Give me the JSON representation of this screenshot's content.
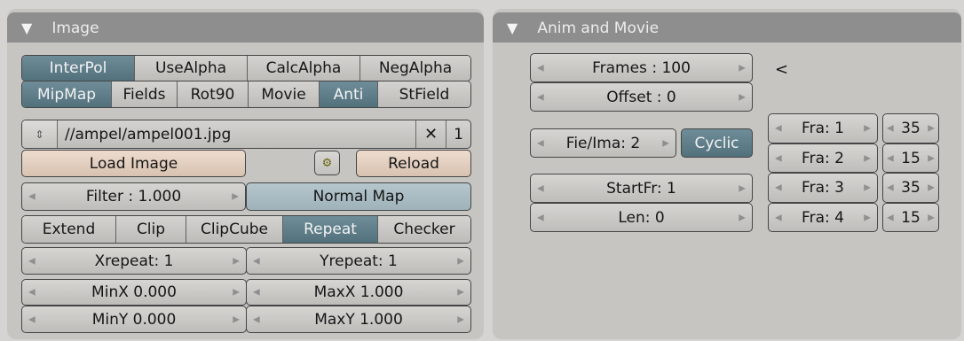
{
  "image_panel": {
    "header_title": "Image",
    "toggle_row1": [
      {
        "label": "InterPol",
        "active": true
      },
      {
        "label": "UseAlpha",
        "active": false
      },
      {
        "label": "CalcAlpha",
        "active": false
      },
      {
        "label": "NegAlpha",
        "active": false
      }
    ],
    "toggle_row2": [
      {
        "label": "MipMap",
        "active": true
      },
      {
        "label": "Fields",
        "active": false
      },
      {
        "label": "Rot90",
        "active": false
      },
      {
        "label": "Movie",
        "active": false
      },
      {
        "label": "Anti",
        "active": true
      },
      {
        "label": "StField",
        "active": false
      }
    ],
    "file_path": "//ampel/ampel001.jpg",
    "user_count": "1",
    "load_image_label": "Load Image",
    "reload_label": "Reload",
    "filter_label": "Filter : 1.000",
    "normal_map_label": "Normal Map",
    "extend_modes": [
      {
        "label": "Extend",
        "active": false
      },
      {
        "label": "Clip",
        "active": false
      },
      {
        "label": "ClipCube",
        "active": false
      },
      {
        "label": "Repeat",
        "active": true
      },
      {
        "label": "Checker",
        "active": false
      }
    ],
    "xrepeat": "Xrepeat: 1",
    "yrepeat": "Yrepeat: 1",
    "minx": "MinX 0.000",
    "maxx": "MaxX 1.000",
    "miny": "MinY 0.000",
    "maxy": "MaxY 1.000"
  },
  "anim_panel": {
    "header_title": "Anim and Movie",
    "frames": "Frames : 100",
    "offset": "Offset : 0",
    "arrow_text": "<",
    "fie_ima": "Fie/Ima: 2",
    "cyclic_label": "Cyclic",
    "startfr": "StartFr: 1",
    "len": "Len: 0",
    "fra_rows": [
      {
        "fra": "Fra: 1",
        "val": "35"
      },
      {
        "fra": "Fra: 2",
        "val": "15"
      },
      {
        "fra": "Fra: 3",
        "val": "35"
      },
      {
        "fra": "Fra: 4",
        "val": "15"
      }
    ]
  },
  "icons": {
    "browse": "updown-arrows-icon",
    "clear": "x-icon",
    "pack": "package-icon",
    "collapse": "triangle-down-icon"
  }
}
